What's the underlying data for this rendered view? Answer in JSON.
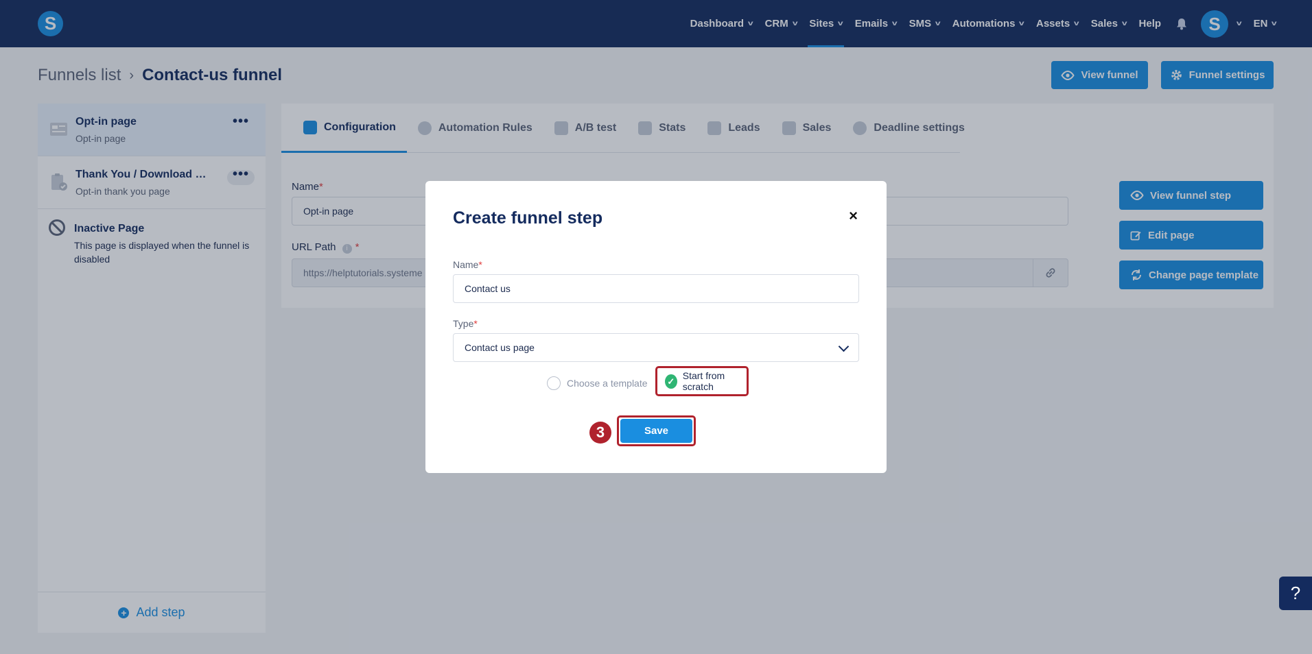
{
  "nav": {
    "logo": "S",
    "items": [
      {
        "label": "Dashboard"
      },
      {
        "label": "CRM"
      },
      {
        "label": "Sites"
      },
      {
        "label": "Emails"
      },
      {
        "label": "SMS"
      },
      {
        "label": "Automations"
      },
      {
        "label": "Assets"
      },
      {
        "label": "Sales"
      }
    ],
    "help_label": "Help",
    "avatar": "S",
    "language": "EN"
  },
  "breadcrumb": {
    "parent": "Funnels list",
    "separator": "›",
    "current": "Contact-us funnel"
  },
  "header_actions": {
    "view_funnel": "View funnel",
    "funnel_settings": "Funnel settings"
  },
  "steps": [
    {
      "title": "Opt-in page",
      "subtitle": "Opt-in page",
      "menu": "•••"
    },
    {
      "title": "Thank You / Download Pa...",
      "subtitle": "Opt-in thank you page",
      "menu": "•••"
    }
  ],
  "inactive_page": {
    "title": "Inactive Page",
    "description": "This page is displayed when the funnel is disabled"
  },
  "add_step": {
    "icon": "+",
    "label": "Add step"
  },
  "tabs": [
    {
      "label": "Configuration",
      "active": true
    },
    {
      "label": "Automation Rules"
    },
    {
      "label": "A/B test"
    },
    {
      "label": "Stats"
    },
    {
      "label": "Leads"
    },
    {
      "label": "Sales"
    },
    {
      "label": "Deadline settings"
    }
  ],
  "form": {
    "name_label": "Name",
    "name_value": "Opt-in page",
    "url_label": "URL Path",
    "url_value": "https://helptutorials.systeme",
    "required_mark": "*"
  },
  "side_actions": {
    "view_funnel_step": "View funnel step",
    "edit_page": "Edit page",
    "change_template": "Change page template"
  },
  "modal": {
    "title": "Create funnel step",
    "close": "×",
    "name_label": "Name",
    "name_value": "Contact us",
    "type_label": "Type",
    "type_value": "Contact us page",
    "option_template": "Choose a template",
    "option_scratch": "Start from scratch",
    "selected_option": "Start from scratch",
    "save_label": "Save",
    "check_mark": "✓",
    "step_marker": "3"
  },
  "help_fab": "?",
  "colors": {
    "nav_bg": "#142b5e",
    "accent": "#1a8ee0",
    "highlight": "#b0222d",
    "success": "#2fb573"
  }
}
